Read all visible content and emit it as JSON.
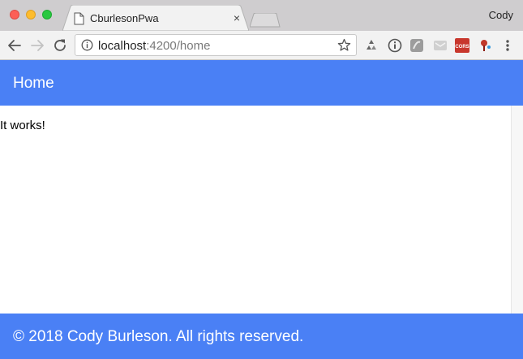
{
  "browser": {
    "tab": {
      "title": "CburlesonPwa",
      "close_glyph": "×",
      "favicon": "page-icon"
    },
    "profile_name": "Cody",
    "address_bar": {
      "host": "localhost",
      "path": ":4200/home"
    },
    "extensions": [
      "recycle-icon",
      "info-circle-icon",
      "gray-square-icon",
      "gray-envelope-icon",
      "cors-icon",
      "pin-icon"
    ],
    "extension_labels": {
      "cors": "CORS"
    }
  },
  "app": {
    "header_title": "Home",
    "content_text": "It works!",
    "footer_text": "© 2018 Cody Burleson. All rights reserved."
  },
  "colors": {
    "primary": "#4a80f5",
    "titlebar": "#cfcdcf",
    "toolbar": "#f2f2f2"
  }
}
